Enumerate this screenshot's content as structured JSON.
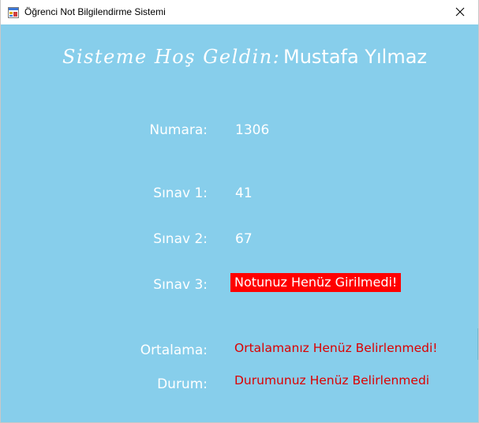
{
  "window": {
    "title": "Öğrenci Not Bilgilendirme Sistemi",
    "icon": "windows-form-icon",
    "close_glyph": "✕"
  },
  "welcome": {
    "greeting": "Sisteme Hoş Geldin:",
    "student_name": "Mustafa Yılmaz"
  },
  "fields": {
    "number_label": "Numara:",
    "number_value": "1306",
    "exam1_label": "Sınav 1:",
    "exam1_value": "41",
    "exam2_label": "Sınav 2:",
    "exam2_value": "67",
    "exam3_label": "Sınav 3:",
    "exam3_value": "Notunuz Henüz Girilmedi!",
    "average_label": "Ortalama:",
    "average_value": "Ortalamanız Henüz Belirlenmedi!",
    "status_label": "Durum:",
    "status_value": "Durumunuz Henüz Belirlenmedi"
  },
  "colors": {
    "background": "#87ceeb",
    "text": "#ffffff",
    "warning_bg": "#ff0000",
    "warning_text": "#dc0000"
  }
}
